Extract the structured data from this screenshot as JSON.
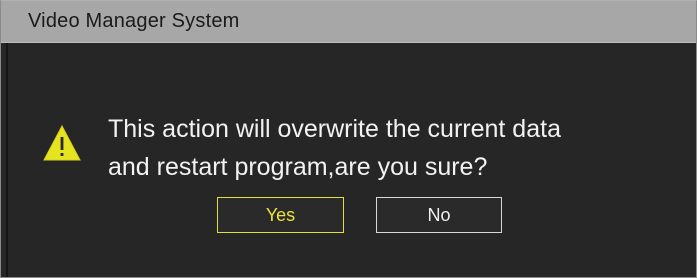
{
  "window": {
    "title": "Video Manager System"
  },
  "dialog": {
    "icon": "warning-icon",
    "message_lines": [
      "This action will overwrite the current data",
      "and restart program,are you sure?"
    ],
    "buttons": {
      "yes_label": "Yes",
      "no_label": "No"
    }
  },
  "colors": {
    "titlebar": "#a7a7a7",
    "body_background": "#262626",
    "accent_yellow": "#e9e338",
    "text": "#f2f2f2"
  }
}
